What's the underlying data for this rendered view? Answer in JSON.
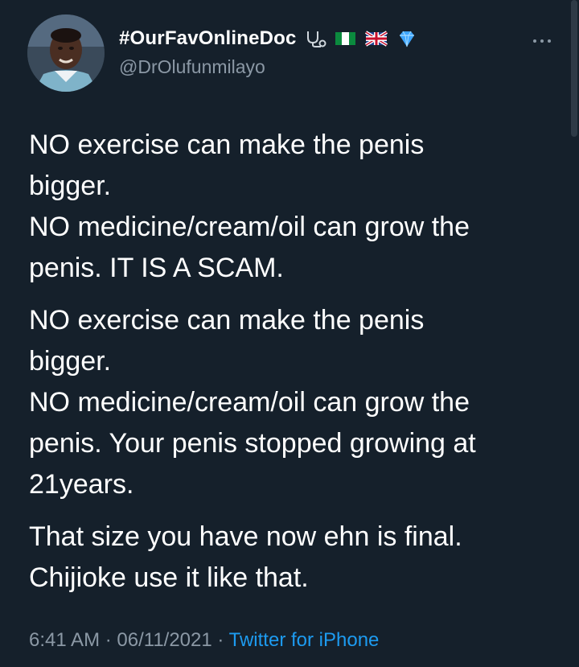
{
  "author": {
    "display_name": "#OurFavOnlineDoc",
    "handle": "@DrOlufunmilayo",
    "badges": [
      "stethoscope-icon",
      "nigeria-flag-icon",
      "uk-flag-icon",
      "gem-icon"
    ]
  },
  "tweet": {
    "paragraphs": [
      [
        "NO exercise can make the penis",
        "bigger.",
        "NO medicine/cream/oil can grow the",
        "penis. IT IS A SCAM."
      ],
      [
        "NO exercise can make the penis",
        "bigger.",
        "NO medicine/cream/oil can grow the",
        "penis. Your penis stopped growing at",
        "21years."
      ],
      [
        "That size you have now ehn is final.",
        "Chijioke use it like that."
      ]
    ]
  },
  "meta": {
    "time": "6:41 AM",
    "separator": " · ",
    "date": "06/11/2021",
    "source": "Twitter for iPhone"
  },
  "colors": {
    "background": "#15202b",
    "text": "#ffffff",
    "secondary": "#8b98a5",
    "link": "#1d9bf0"
  }
}
